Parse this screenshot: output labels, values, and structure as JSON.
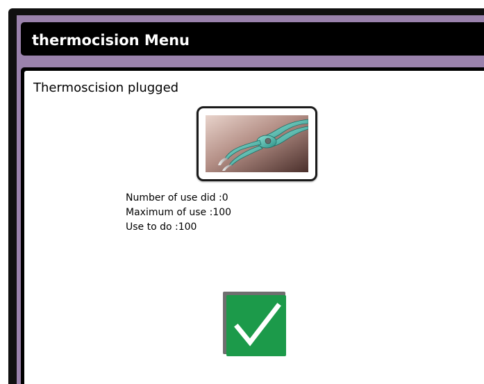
{
  "window": {
    "title": "thermocision Menu"
  },
  "main": {
    "status": "Thermoscision plugged",
    "instrument_icon": "thermocision-forceps-icon",
    "usage": {
      "number_of_use_did": "Number of use did :0",
      "maximum_of_use": "Maximum of use :100",
      "use_to_do": "Use to do :100"
    },
    "confirm_icon": "checkmark-icon"
  },
  "colors": {
    "frame_purple": "#9a82ac",
    "title_bar": "#000000",
    "confirm_green": "#1c9a4a"
  }
}
